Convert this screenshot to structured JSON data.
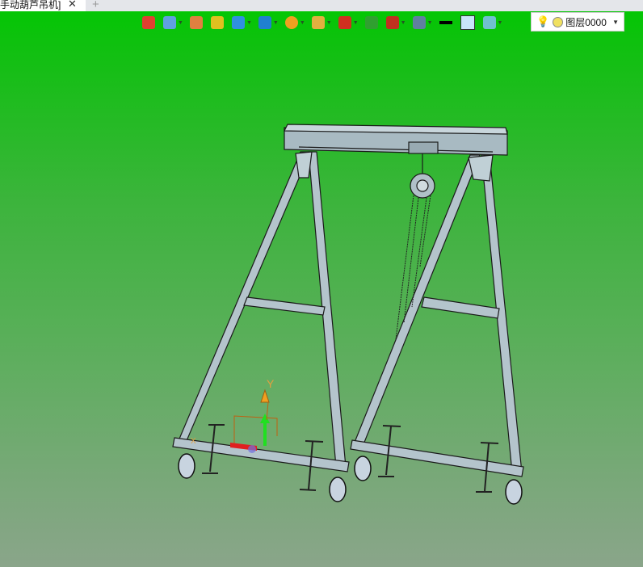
{
  "tab": {
    "title": "手动葫芦吊机]",
    "close": "✕",
    "new_tab": "+"
  },
  "toolbar": {
    "buttons": [
      {
        "icon": "exit-icon",
        "color": "#e04030",
        "dropdown": false
      },
      {
        "icon": "light-icon",
        "color": "#60a0e0",
        "dropdown": true
      },
      {
        "icon": "brush-icon",
        "color": "#e08040",
        "dropdown": false
      },
      {
        "icon": "box-texture-icon",
        "color": "#e0c020",
        "dropdown": false
      },
      {
        "icon": "cube-icon",
        "color": "#3090e0",
        "dropdown": true
      },
      {
        "icon": "view-cube-icon",
        "color": "#2080d0",
        "dropdown": true
      },
      {
        "icon": "render-ball-icon",
        "color": "#f0a020",
        "dropdown": true
      },
      {
        "icon": "zoom-icon",
        "color": "#e0b040",
        "dropdown": true
      },
      {
        "icon": "rotate-icon",
        "color": "#d03020",
        "dropdown": true
      },
      {
        "icon": "fit-view-icon",
        "color": "#30a030",
        "dropdown": false
      },
      {
        "icon": "section-icon",
        "color": "#c03020",
        "dropdown": true
      },
      {
        "icon": "display-icon",
        "color": "#6080a0",
        "dropdown": true
      },
      {
        "icon": "line-style-icon",
        "color": "#000000",
        "dropdown": false
      },
      {
        "icon": "color-fill-icon",
        "color": "#c8e4f8",
        "dropdown": false
      },
      {
        "icon": "layer-stack-icon",
        "color": "#70c0d0",
        "dropdown": true
      }
    ]
  },
  "layer_select": {
    "value": "图层0000",
    "arrow": "▼"
  },
  "axis": {
    "y_label": "Y",
    "x_label": "X"
  }
}
